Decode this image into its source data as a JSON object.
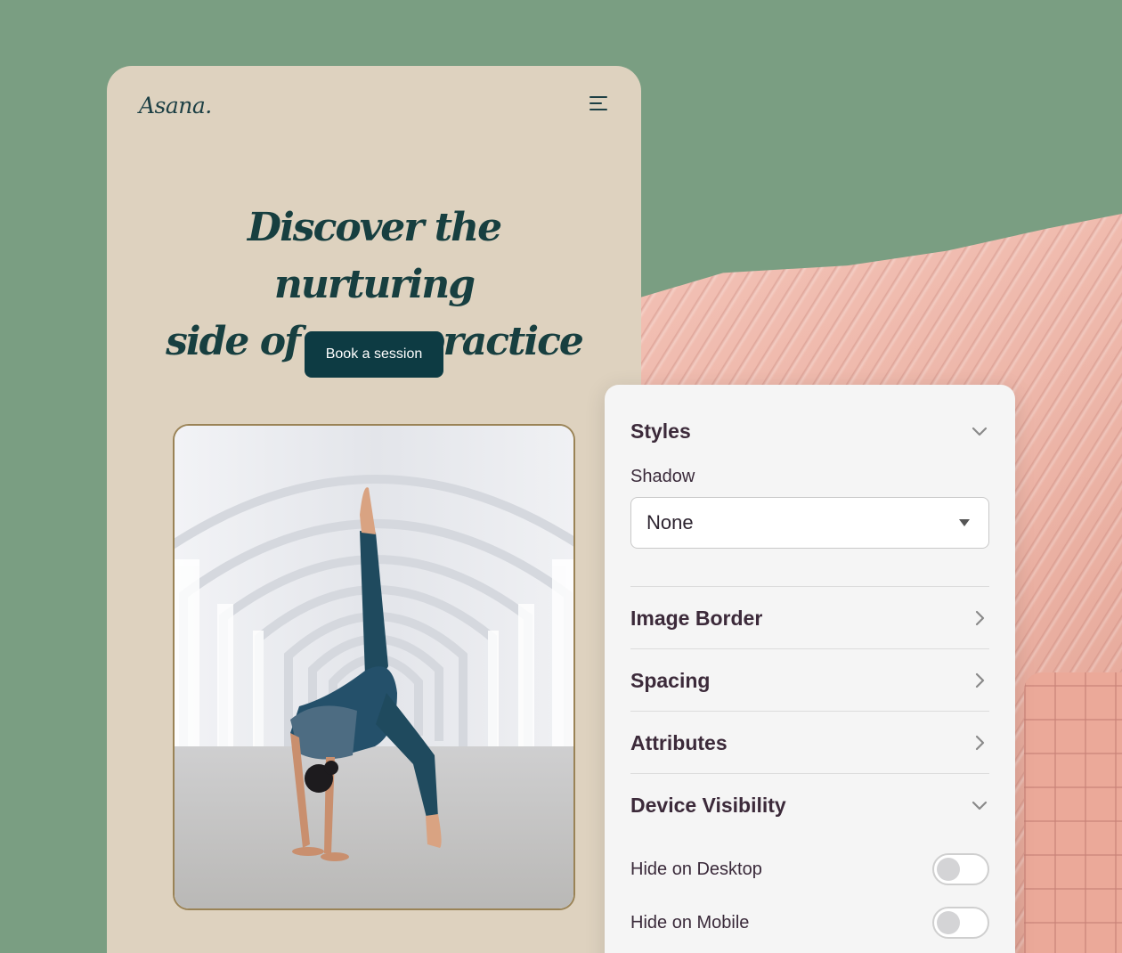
{
  "brand": {
    "name": "Asana."
  },
  "hero": {
    "title_line1": "Discover the nurturing",
    "title_line2": "side of yoga practice",
    "cta_label": "Book a session"
  },
  "panel": {
    "styles": {
      "title": "Styles",
      "shadow_label": "Shadow",
      "shadow_value": "None"
    },
    "sections": [
      {
        "title": "Image Border"
      },
      {
        "title": "Spacing"
      },
      {
        "title": "Attributes"
      }
    ],
    "device_visibility": {
      "title": "Device Visibility",
      "toggles": [
        {
          "label": "Hide on Desktop",
          "on": false
        },
        {
          "label": "Hide on Mobile",
          "on": false
        }
      ]
    }
  },
  "colors": {
    "background": "#7a9e82",
    "card": "#ded2bf",
    "accent": "#0d3b43",
    "panel": "#f5f5f5"
  },
  "icons": {
    "menu": "hamburger-icon",
    "collapse": "chevron-down-icon",
    "expand": "chevron-right-icon",
    "dropdown": "caret-down-icon"
  }
}
